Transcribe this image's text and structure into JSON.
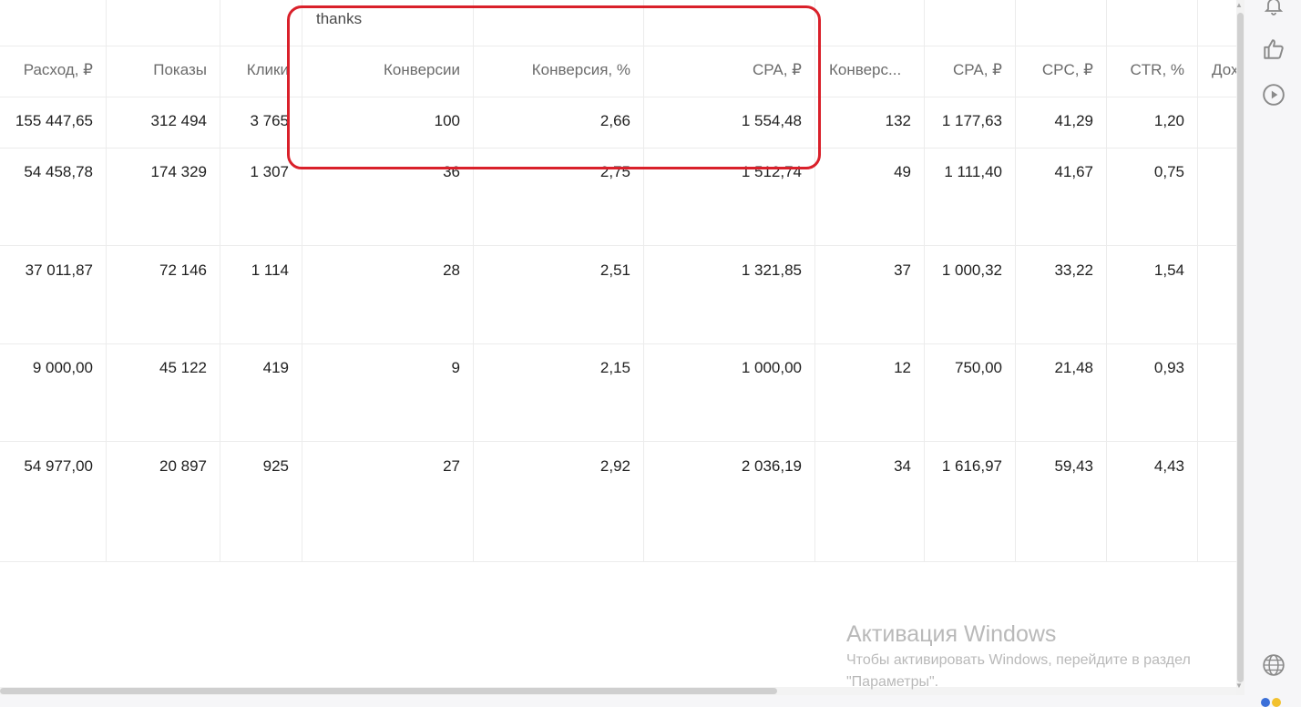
{
  "group_label": "thanks",
  "headers": [
    "Расход, ₽",
    "Показы",
    "Клики",
    "Конверсии",
    "Конверсия, %",
    "CPA, ₽",
    "Конверс...",
    "CPA, ₽",
    "CPC, ₽",
    "CTR, %",
    "Доход"
  ],
  "rows": [
    [
      "155 447,65",
      "312 494",
      "3 765",
      "100",
      "2,66",
      "1 554,48",
      "132",
      "1 177,63",
      "41,29",
      "1,20",
      ""
    ],
    [
      "54 458,78",
      "174 329",
      "1 307",
      "36",
      "2,75",
      "1 512,74",
      "49",
      "1 111,40",
      "41,67",
      "0,75",
      ""
    ],
    [
      "37 011,87",
      "72 146",
      "1 114",
      "28",
      "2,51",
      "1 321,85",
      "37",
      "1 000,32",
      "33,22",
      "1,54",
      ""
    ],
    [
      "9 000,00",
      "45 122",
      "419",
      "9",
      "2,15",
      "1 000,00",
      "12",
      "750,00",
      "21,48",
      "0,93",
      ""
    ],
    [
      "54 977,00",
      "20 897",
      "925",
      "27",
      "2,92",
      "2 036,19",
      "34",
      "1 616,97",
      "59,43",
      "4,43",
      ""
    ]
  ],
  "watermark": {
    "title": "Активация Windows",
    "line1": "Чтобы активировать Windows, перейдите в раздел",
    "line2": "\"Параметры\"."
  },
  "right_panel_icons": [
    "bell-icon",
    "thumbs-up-icon",
    "play-icon",
    "globe-icon"
  ],
  "colors": {
    "highlight": "#d9202a",
    "grid": "#ececec",
    "header_text": "#6b6b6b"
  }
}
